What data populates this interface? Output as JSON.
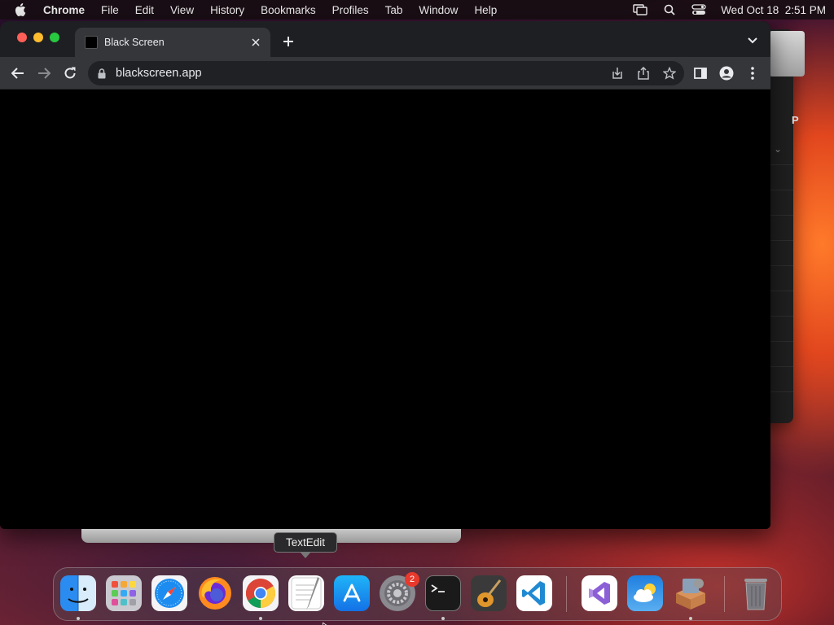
{
  "menubar": {
    "app_name": "Chrome",
    "items": [
      "File",
      "Edit",
      "View",
      "History",
      "Bookmarks",
      "Profiles",
      "Tab",
      "Window",
      "Help"
    ],
    "datetime": "Wed Oct 18  2:51 PM"
  },
  "browser": {
    "tab_title": "Black Screen",
    "url": "blackscreen.app"
  },
  "background_window": {
    "letter": "P"
  },
  "tooltip": {
    "text": "TextEdit"
  },
  "dock": {
    "apps": [
      "Finder",
      "Launchpad",
      "Safari",
      "Firefox",
      "Google Chrome",
      "TextEdit",
      "App Store",
      "System Settings",
      "Terminal",
      "GarageBand",
      "Visual Studio Code",
      "Visual Studio",
      "Weather",
      "Installer",
      "Trash"
    ],
    "settings_badge": "2"
  },
  "colors": {
    "traffic_red": "#ff5f57",
    "traffic_yellow": "#febc2e",
    "traffic_green": "#28c840",
    "badge": "#e8392c"
  }
}
